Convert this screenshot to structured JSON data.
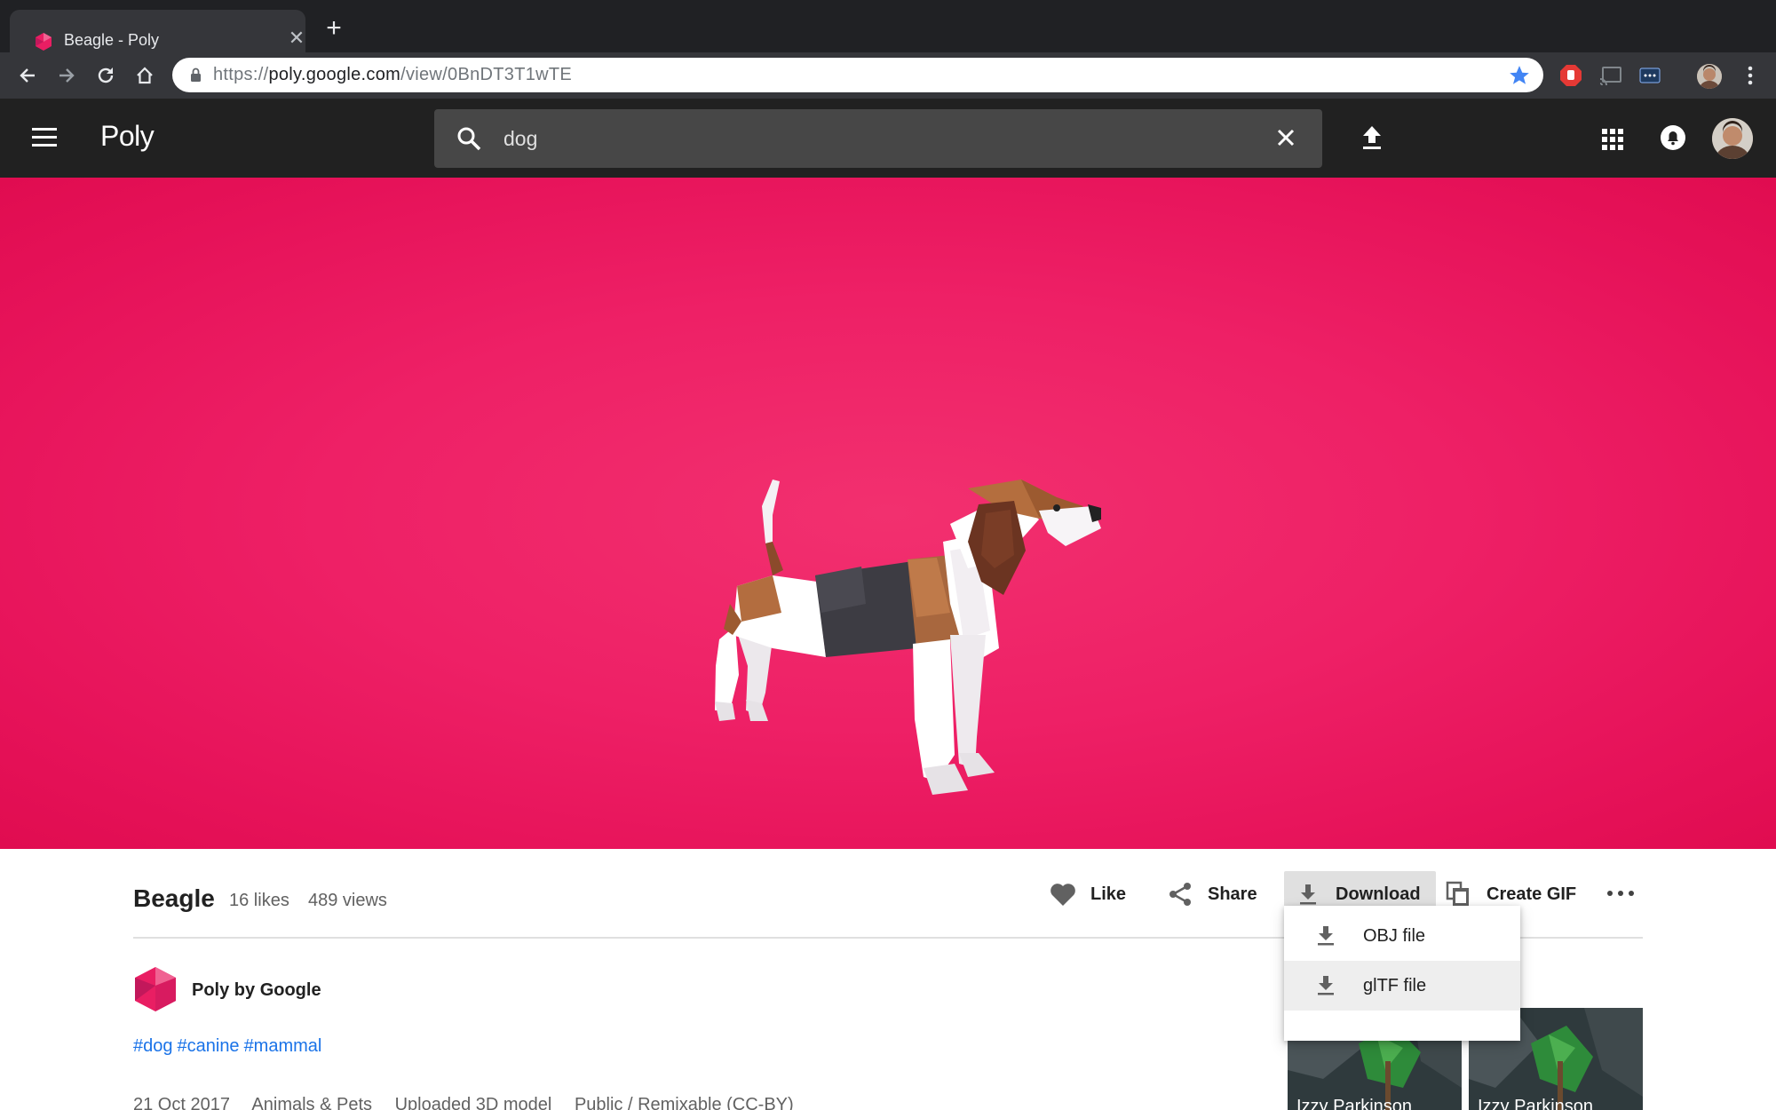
{
  "browser": {
    "tab_title": "Beagle - Poly",
    "tab_close": "✕",
    "new_tab": "+",
    "url": {
      "scheme": "https://",
      "host": "poly.google.com",
      "path": "/view/0BnDT3T1wTE"
    }
  },
  "poly_header": {
    "logo": "Poly",
    "search_value": "dog"
  },
  "asset": {
    "title": "Beagle",
    "likes": "16 likes",
    "views": "489 views"
  },
  "actions": {
    "like": "Like",
    "share": "Share",
    "download": "Download",
    "create_gif": "Create GIF"
  },
  "download_menu": {
    "items": [
      {
        "label": "OBJ file",
        "icon": "download-icon",
        "highlighted": false
      },
      {
        "label": "glTF file",
        "icon": "download-icon",
        "highlighted": true
      }
    ]
  },
  "author": {
    "name": "Poly by Google"
  },
  "tags": [
    "#dog",
    "#canine",
    "#mammal"
  ],
  "meta": {
    "date": "21 Oct 2017",
    "category": "Animals & Pets",
    "type": "Uploaded 3D model",
    "license": "Public / Remixable (CC-BY)"
  },
  "related": [
    {
      "label": "Izzy Parkinson"
    },
    {
      "label": "Izzy Parkinson"
    }
  ],
  "colors": {
    "hero": "#ee2066",
    "header": "#212121",
    "link": "#1a73e8",
    "chrome_dark": "#202124"
  }
}
